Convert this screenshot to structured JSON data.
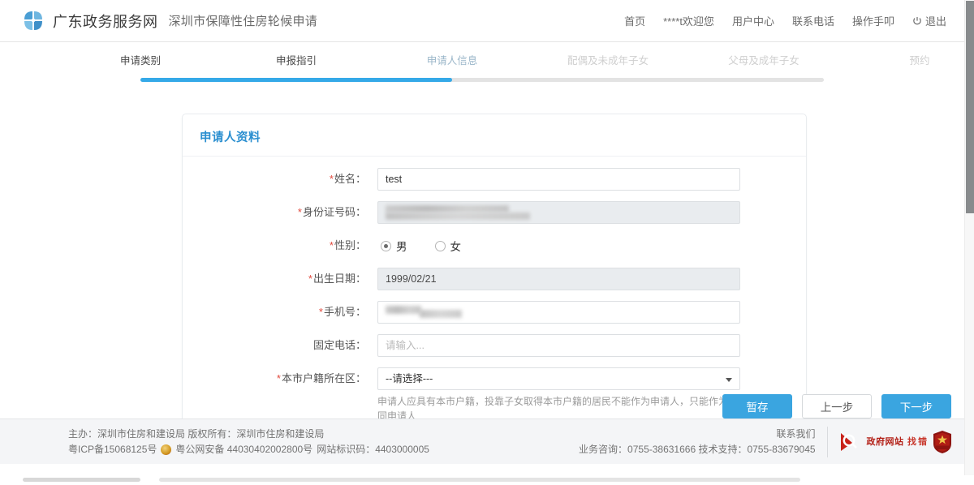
{
  "header": {
    "logo_icon": "pinwheel-logo-icon",
    "brand_title": "广东政务服务网",
    "brand_subtitle": "深圳市保障性住房轮候申请",
    "nav": [
      {
        "label": "首页",
        "name": "nav-home"
      },
      {
        "label": "****t欢迎您",
        "name": "nav-welcome-user"
      },
      {
        "label": "用户中心",
        "name": "nav-user-center"
      },
      {
        "label": "联系电话",
        "name": "nav-contact-phone"
      },
      {
        "label": "操作手叩",
        "name": "nav-manual"
      }
    ],
    "logout_label": "退出",
    "logout_icon": "power-icon"
  },
  "stepper": {
    "steps": [
      {
        "label": "申请类别",
        "state": "done"
      },
      {
        "label": "申报指引",
        "state": "done"
      },
      {
        "label": "申请人信息",
        "state": "current"
      },
      {
        "label": "配偶及未成年子女",
        "state": "todo"
      },
      {
        "label": "父母及成年子女",
        "state": "todo"
      },
      {
        "label": "预约",
        "state": "todo"
      }
    ]
  },
  "card": {
    "title": "申请人资料",
    "fields": {
      "name": {
        "label": "姓名：",
        "required": true,
        "value": "test",
        "placeholder": ""
      },
      "id_number": {
        "label": "身份证号码：",
        "required": true,
        "value": "",
        "redacted": true,
        "disabled": true
      },
      "gender": {
        "label": "性别：",
        "required": true,
        "options": [
          {
            "label": "男",
            "checked": true
          },
          {
            "label": "女",
            "checked": false
          }
        ]
      },
      "birth_date": {
        "label": "出生日期：",
        "required": true,
        "value": "1999/02/21",
        "disabled": true
      },
      "mobile": {
        "label": "手机号：",
        "required": true,
        "value": "",
        "redacted": true
      },
      "landline": {
        "label": "固定电话：",
        "required": false,
        "value": "",
        "placeholder": "请输入..."
      },
      "district": {
        "label": "本市户籍所在区：",
        "required": true,
        "value": "--请选择---",
        "caret_icon": "chevron-down-icon",
        "help_text": "申请人应具有本市户籍，投靠子女取得本市户籍的居民不能作为申请人，只能作为共同申请人"
      }
    }
  },
  "actions": {
    "save_draft": "暂存",
    "previous": "上一步",
    "next": "下一步"
  },
  "footer": {
    "org_line": "主办：深圳市住房和建设局 版权所有：深圳市住房和建设局",
    "icp": "粤ICP备15068125号",
    "police_icon": "police-badge-icon",
    "police_record": "粤公网安备 44030402002800号",
    "site_id": "网站标识码：4403000005",
    "contact_title": "联系我们",
    "contact_line": "业务咨询：0755-38631666 技术支持：0755-83679045",
    "gov_badge": {
      "icon": "magnifier-icon",
      "line1": "政府网站",
      "line2": "找错"
    },
    "shield_icon": "gov-shield-icon"
  },
  "colors": {
    "accent_blue": "#3aa5e0",
    "step_done": "#45b0ea",
    "step_current": "#2b7fc0",
    "title_blue": "#2b8fd0",
    "required_red": "#e24a3e",
    "gov_red": "#b32017"
  }
}
